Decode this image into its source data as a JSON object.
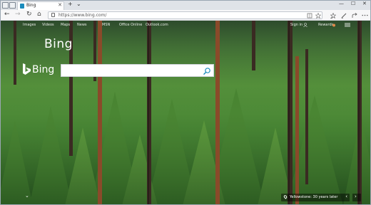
{
  "browser": {
    "tab_title": "Bing",
    "tab_close": "✕",
    "new_tab": "+",
    "tab_menu": "⌄",
    "url": "https://www.bing.com/",
    "window_minimize": "—",
    "window_maximize": "☐",
    "window_close": "✕",
    "nav_back": "←",
    "nav_forward": "→",
    "nav_refresh": "↻",
    "nav_home": "⌂",
    "toolbar_icons": [
      "reading-view-icon",
      "favorite-star-icon",
      "favorites-hub-icon",
      "pen-icon",
      "share-icon",
      "more-icon"
    ]
  },
  "bing": {
    "top_nav": [
      "Images",
      "Videos",
      "Maps",
      "News",
      "MSN",
      "Office Online",
      "Outlook.com"
    ],
    "sign_in": "Sign in",
    "rewards": "Rewards",
    "headline": "Bing",
    "logo_text": "Bing",
    "search_value": "",
    "search_placeholder": "",
    "image_caption": "Yellowstone: 30 years later",
    "caption_prev": "‹",
    "caption_next": "›",
    "scroll_down": "⌄",
    "accent": "#1b8cbc"
  }
}
